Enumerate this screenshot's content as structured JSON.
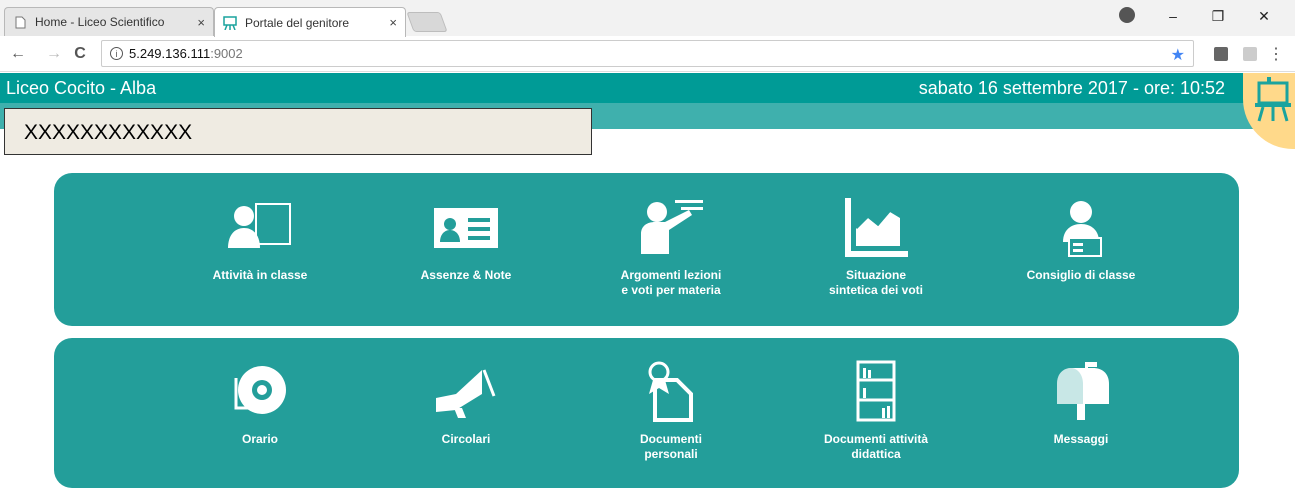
{
  "browser": {
    "tabs": [
      {
        "title": "Home - Liceo Scientifico",
        "close": "×",
        "active": false
      },
      {
        "title": "Portale del genitore",
        "close": "×",
        "active": true
      }
    ],
    "window_controls": {
      "minimize": "–",
      "maximize": "❐",
      "close": "✕"
    },
    "nav": {
      "back": "←",
      "forward": "→",
      "reload": "C"
    },
    "url_host": "5.249.136.111",
    "url_port": ":9002",
    "info_glyph": "i",
    "bookmark_star": "★",
    "menu": "⋮"
  },
  "header": {
    "school": "Liceo Cocito - Alba",
    "datetime": "sabato 16 settembre 2017 - ore: 10:52"
  },
  "user_box": {
    "text": "XXXXXXXXXXXX"
  },
  "colors": {
    "teal": "#009b96",
    "panel": "#239e9a",
    "subheader": "#3fb0ad",
    "logo_bg": "#ffd98a"
  },
  "panels": [
    {
      "items": [
        {
          "icon": "teacher-board-icon",
          "line1": "Attività in classe",
          "line2": ""
        },
        {
          "icon": "id-card-icon",
          "line1": "Assenze & Note",
          "line2": ""
        },
        {
          "icon": "lesson-presenter-icon",
          "line1": "Argomenti lezioni",
          "line2": "e voti per materia"
        },
        {
          "icon": "chart-icon",
          "line1": "Situazione",
          "line2": "sintetica dei voti"
        },
        {
          "icon": "council-icon",
          "line1": "Consiglio di classe",
          "line2": ""
        }
      ]
    },
    {
      "items": [
        {
          "icon": "bell-icon",
          "line1": "Orario",
          "line2": ""
        },
        {
          "icon": "megaphone-icon",
          "line1": "Circolari",
          "line2": ""
        },
        {
          "icon": "document-award-icon",
          "line1": "Documenti",
          "line2": "personali"
        },
        {
          "icon": "bookshelf-icon",
          "line1": "Documenti attività",
          "line2": "didattica"
        },
        {
          "icon": "mailbox-icon",
          "line1": "Messaggi",
          "line2": ""
        }
      ]
    }
  ]
}
